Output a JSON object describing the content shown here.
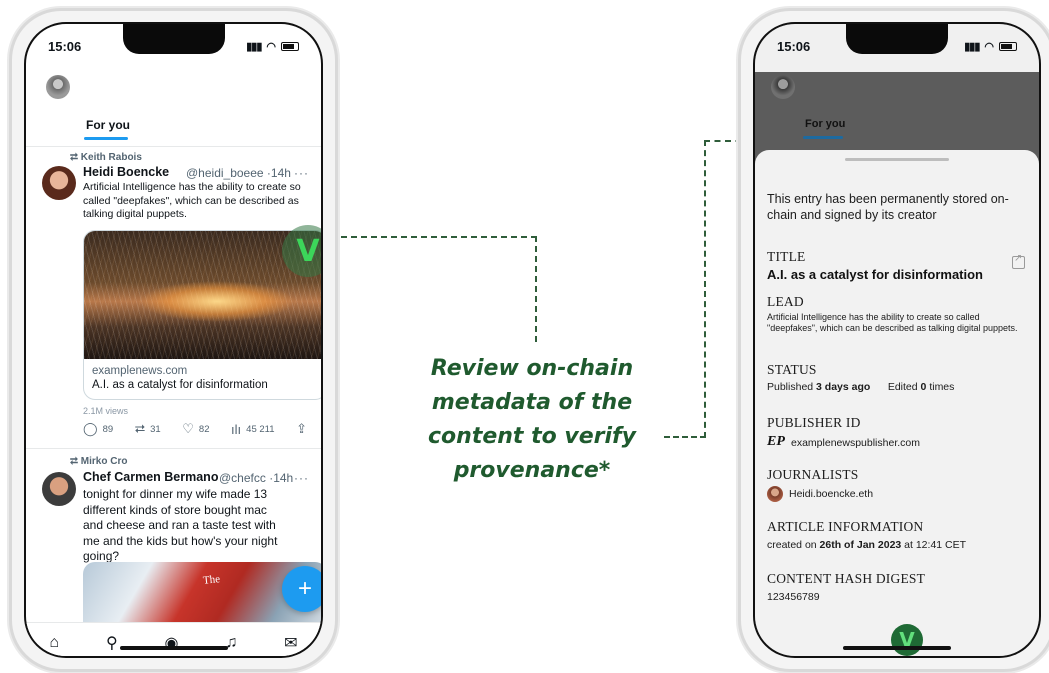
{
  "left_phone": {
    "status": {
      "time": "15:06"
    },
    "tab": "For you",
    "tweets": [
      {
        "retweeted_by": "Keith Rabois",
        "name": "Heidi Boencke",
        "handle": "@heidi_boeee ·14h",
        "more": "···",
        "text": "Artificial Intelligence has the ability to create so called \"deepfakes\", which can be described as talking digital puppets.",
        "card": {
          "domain": "examplenews.com",
          "title": "A.I. as a catalyst for disinformation"
        },
        "verify_mark": "V",
        "views": "2.1M views",
        "actions": {
          "replies": "89",
          "retweets": "31",
          "likes": "82",
          "views": "45 211"
        }
      },
      {
        "retweeted_by": "Mirko Cro",
        "name": "Chef Carmen Bermano",
        "handle": "@chefcc ·14h",
        "more": "···",
        "text": "tonight for dinner my wife made 13 different kinds of store bought mac and cheese and ran a taste test with me and the kids but how's your night going?",
        "image_text": "The"
      }
    ],
    "fab_label": "+",
    "nav_icons": [
      "home-icon",
      "search-icon",
      "spaces-icon",
      "bell-icon",
      "mail-icon"
    ]
  },
  "caption": "Review on-chain metadata of the content to verify provenance*",
  "right_phone": {
    "status": {
      "time": "15:06"
    },
    "tab": "For you",
    "sheet": {
      "intro": "This entry has been permanently stored on-chain and signed by its creator",
      "title_label": "TITLE",
      "title_value": "A.I. as a catalyst for disinformation",
      "lead_label": "LEAD",
      "lead_value": "Artificial Intelligence has the ability to create so called \"deepfakes\", which can be described as talking digital puppets.",
      "status_label": "STATUS",
      "status_published_prefix": "Published",
      "status_published_value": "3 days ago",
      "status_edited_prefix": "Edited",
      "status_edited_value": "0",
      "status_edited_suffix": "times",
      "publisher_label": "PUBLISHER ID",
      "publisher_logo": "EP",
      "publisher_value": "examplenewspublisher.com",
      "journalists_label": "JOURNALISTS",
      "journalist_value": "Heidi.boencke.eth",
      "article_label": "ARTICLE INFORMATION",
      "article_prefix": "created on",
      "article_date": "26th of Jan 2023",
      "article_suffix": "at 12:41 CET",
      "hash_label": "CONTENT HASH DIGEST",
      "hash_value": "123456789",
      "verify_mark": "V"
    }
  },
  "colors": {
    "accent_blue": "#1d9bf0",
    "connector_green": "#2f5d3a",
    "caption_green": "#1f5a2e",
    "verify_green": "#1f6a35"
  }
}
